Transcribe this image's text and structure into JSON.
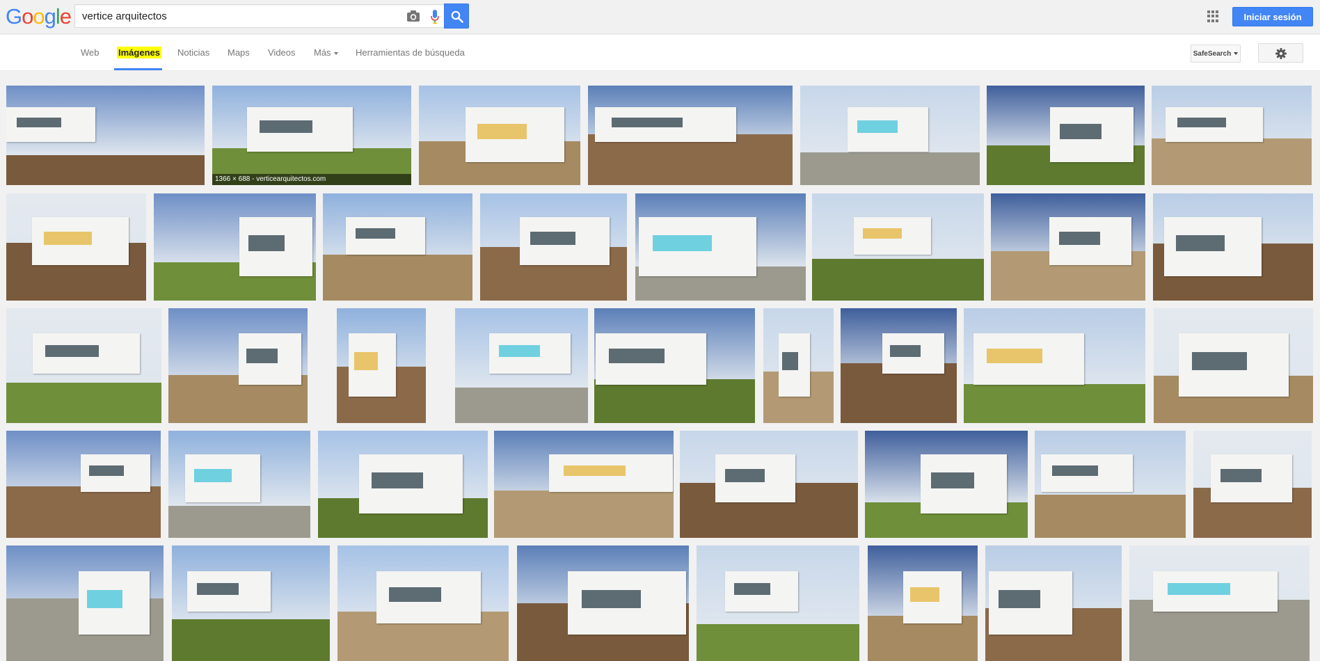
{
  "logo": {
    "letters": [
      "G",
      "o",
      "o",
      "g",
      "l",
      "e"
    ],
    "colors": [
      "#4285f4",
      "#ea4335",
      "#fbbc05",
      "#4285f4",
      "#34a853",
      "#ea4335"
    ]
  },
  "search": {
    "query": "vertice arquitectos",
    "button_icon": "search-icon",
    "camera_icon": "camera-icon",
    "mic_icon": "mic-icon"
  },
  "header": {
    "signin_label": "Iniciar sesión",
    "apps_icon": "apps-grid-icon",
    "accent": "#4285f4"
  },
  "nav": {
    "tabs": [
      {
        "label": "Web",
        "active": false
      },
      {
        "label": "Imágenes",
        "active": true
      },
      {
        "label": "Noticias",
        "active": false
      },
      {
        "label": "Maps",
        "active": false
      },
      {
        "label": "Videos",
        "active": false
      },
      {
        "label": "Más",
        "active": false,
        "dropdown": true
      },
      {
        "label": "Herramientas de búsqueda",
        "active": false
      }
    ],
    "safesearch_label": "SafeSearch",
    "settings_icon": "gear-icon"
  },
  "results": {
    "first_caption": "1366 × 688 - verticearquitectos.com",
    "count": 42
  }
}
